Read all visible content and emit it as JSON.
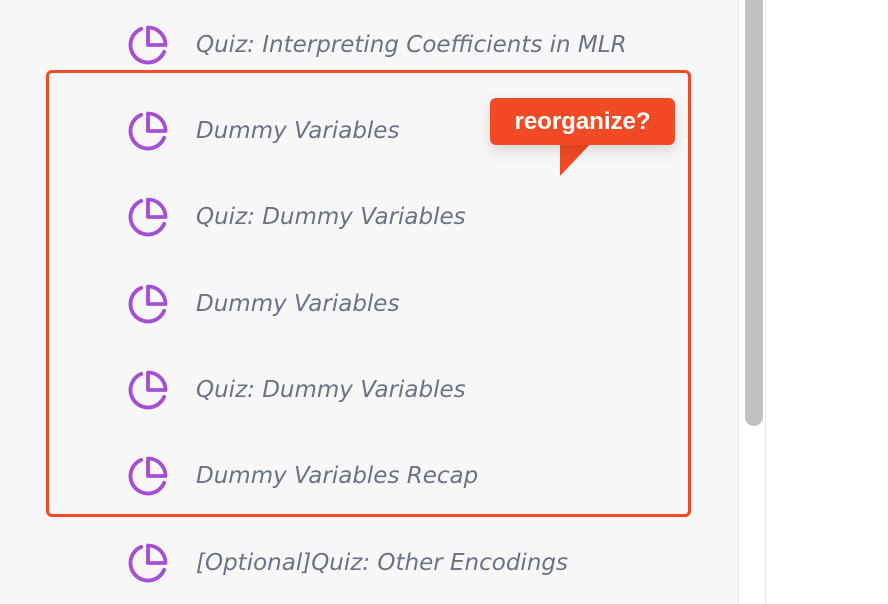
{
  "lessons": [
    {
      "label": "Quiz: Interpreting Coefficients in MLR",
      "icon": "pie-chart-icon"
    },
    {
      "label": "Dummy Variables",
      "icon": "pie-chart-icon"
    },
    {
      "label": "Quiz: Dummy Variables",
      "icon": "pie-chart-icon"
    },
    {
      "label": "Dummy Variables",
      "icon": "pie-chart-icon"
    },
    {
      "label": "Quiz: Dummy Variables",
      "icon": "pie-chart-icon"
    },
    {
      "label": "Dummy Variables Recap",
      "icon": "pie-chart-icon"
    },
    {
      "label": "[Optional]Quiz: Other Encodings",
      "icon": "pie-chart-icon"
    }
  ],
  "annotation": {
    "callout_text": "reorganize?"
  },
  "colors": {
    "icon": "#a64fd6",
    "label": "#6a7283",
    "annotation": "#f24a24",
    "sidebar_bg": "#f7f7f7",
    "scrollbar_thumb": "#c1c1c1"
  }
}
